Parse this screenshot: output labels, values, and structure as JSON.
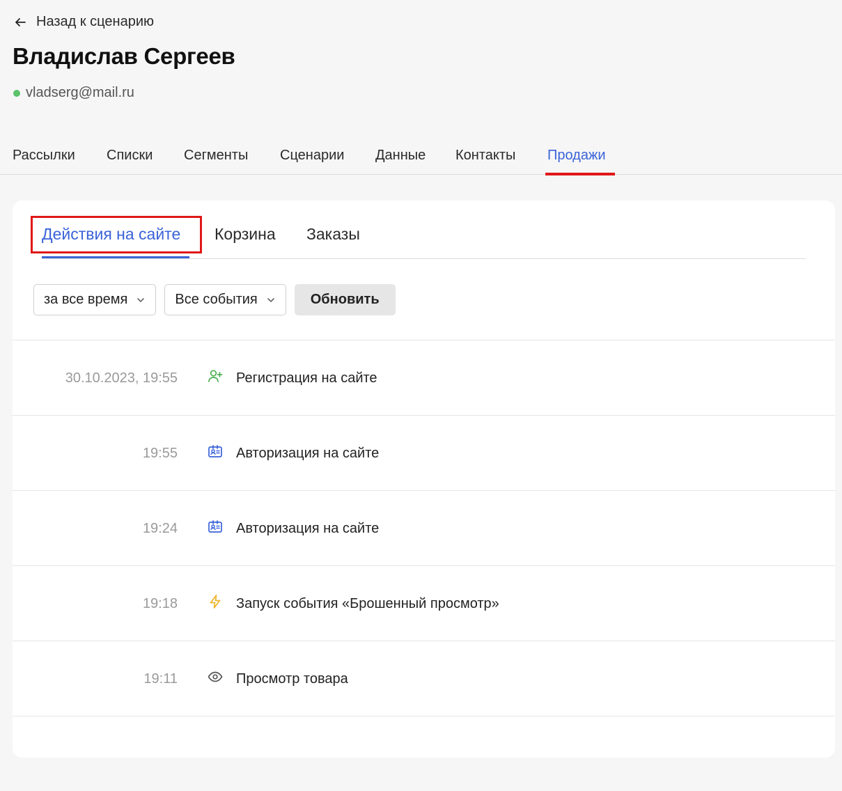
{
  "header": {
    "back_label": "Назад к сценарию",
    "contact_name": "Владислав Сергеев",
    "email": "vladserg@mail.ru",
    "status_color": "#5cc26b"
  },
  "main_tabs": [
    {
      "label": "Рассылки"
    },
    {
      "label": "Списки"
    },
    {
      "label": "Сегменты"
    },
    {
      "label": "Сценарии"
    },
    {
      "label": "Данные"
    },
    {
      "label": "Контакты"
    },
    {
      "label": "Продажи",
      "active": true
    }
  ],
  "sub_tabs": [
    {
      "label": "Действия на сайте",
      "active": true
    },
    {
      "label": "Корзина"
    },
    {
      "label": "Заказы"
    }
  ],
  "filters": {
    "period": "за все время",
    "events": "Все события",
    "refresh_label": "Обновить"
  },
  "events": [
    {
      "time": "30.10.2023, 19:55",
      "icon": "user-plus-icon",
      "label": "Регистрация на сайте"
    },
    {
      "time": "19:55",
      "icon": "id-card-icon",
      "label": "Авторизация на сайте"
    },
    {
      "time": "19:24",
      "icon": "id-card-icon",
      "label": "Авторизация на сайте"
    },
    {
      "time": "19:18",
      "icon": "lightning-icon",
      "label": "Запуск события «Брошенный просмотр»"
    },
    {
      "time": "19:11",
      "icon": "eye-icon",
      "label": "Просмотр товара"
    }
  ],
  "colors": {
    "accent": "#3a63d8",
    "highlight": "#e01818",
    "user_plus_icon": "#4caf50",
    "id_card_icon": "#3a63d8",
    "lightning_icon": "#f0b429",
    "eye_icon": "#555555"
  }
}
